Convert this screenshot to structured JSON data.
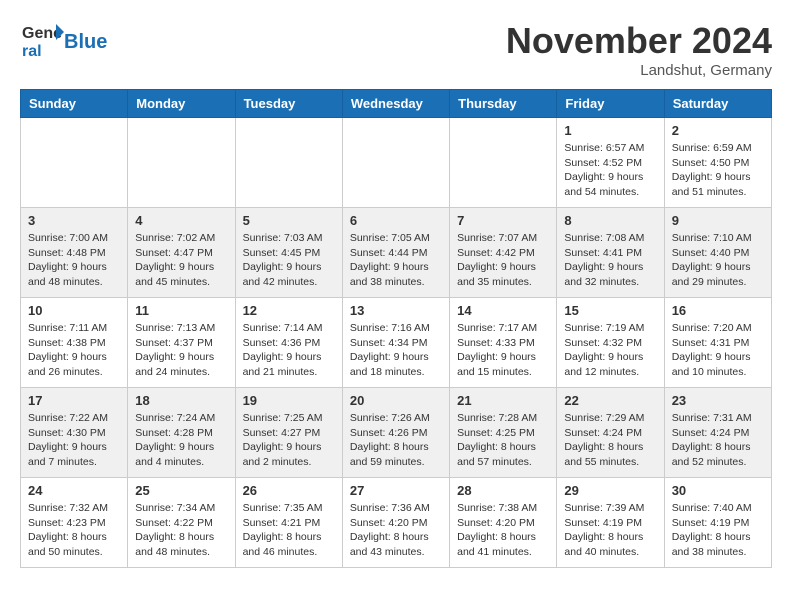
{
  "header": {
    "logo_line1": "General",
    "logo_line2": "Blue",
    "month": "November 2024",
    "location": "Landshut, Germany"
  },
  "weekdays": [
    "Sunday",
    "Monday",
    "Tuesday",
    "Wednesday",
    "Thursday",
    "Friday",
    "Saturday"
  ],
  "weeks": [
    {
      "days": [
        {
          "num": "",
          "info": ""
        },
        {
          "num": "",
          "info": ""
        },
        {
          "num": "",
          "info": ""
        },
        {
          "num": "",
          "info": ""
        },
        {
          "num": "",
          "info": ""
        },
        {
          "num": "1",
          "info": "Sunrise: 6:57 AM\nSunset: 4:52 PM\nDaylight: 9 hours\nand 54 minutes."
        },
        {
          "num": "2",
          "info": "Sunrise: 6:59 AM\nSunset: 4:50 PM\nDaylight: 9 hours\nand 51 minutes."
        }
      ]
    },
    {
      "days": [
        {
          "num": "3",
          "info": "Sunrise: 7:00 AM\nSunset: 4:48 PM\nDaylight: 9 hours\nand 48 minutes."
        },
        {
          "num": "4",
          "info": "Sunrise: 7:02 AM\nSunset: 4:47 PM\nDaylight: 9 hours\nand 45 minutes."
        },
        {
          "num": "5",
          "info": "Sunrise: 7:03 AM\nSunset: 4:45 PM\nDaylight: 9 hours\nand 42 minutes."
        },
        {
          "num": "6",
          "info": "Sunrise: 7:05 AM\nSunset: 4:44 PM\nDaylight: 9 hours\nand 38 minutes."
        },
        {
          "num": "7",
          "info": "Sunrise: 7:07 AM\nSunset: 4:42 PM\nDaylight: 9 hours\nand 35 minutes."
        },
        {
          "num": "8",
          "info": "Sunrise: 7:08 AM\nSunset: 4:41 PM\nDaylight: 9 hours\nand 32 minutes."
        },
        {
          "num": "9",
          "info": "Sunrise: 7:10 AM\nSunset: 4:40 PM\nDaylight: 9 hours\nand 29 minutes."
        }
      ]
    },
    {
      "days": [
        {
          "num": "10",
          "info": "Sunrise: 7:11 AM\nSunset: 4:38 PM\nDaylight: 9 hours\nand 26 minutes."
        },
        {
          "num": "11",
          "info": "Sunrise: 7:13 AM\nSunset: 4:37 PM\nDaylight: 9 hours\nand 24 minutes."
        },
        {
          "num": "12",
          "info": "Sunrise: 7:14 AM\nSunset: 4:36 PM\nDaylight: 9 hours\nand 21 minutes."
        },
        {
          "num": "13",
          "info": "Sunrise: 7:16 AM\nSunset: 4:34 PM\nDaylight: 9 hours\nand 18 minutes."
        },
        {
          "num": "14",
          "info": "Sunrise: 7:17 AM\nSunset: 4:33 PM\nDaylight: 9 hours\nand 15 minutes."
        },
        {
          "num": "15",
          "info": "Sunrise: 7:19 AM\nSunset: 4:32 PM\nDaylight: 9 hours\nand 12 minutes."
        },
        {
          "num": "16",
          "info": "Sunrise: 7:20 AM\nSunset: 4:31 PM\nDaylight: 9 hours\nand 10 minutes."
        }
      ]
    },
    {
      "days": [
        {
          "num": "17",
          "info": "Sunrise: 7:22 AM\nSunset: 4:30 PM\nDaylight: 9 hours\nand 7 minutes."
        },
        {
          "num": "18",
          "info": "Sunrise: 7:24 AM\nSunset: 4:28 PM\nDaylight: 9 hours\nand 4 minutes."
        },
        {
          "num": "19",
          "info": "Sunrise: 7:25 AM\nSunset: 4:27 PM\nDaylight: 9 hours\nand 2 minutes."
        },
        {
          "num": "20",
          "info": "Sunrise: 7:26 AM\nSunset: 4:26 PM\nDaylight: 8 hours\nand 59 minutes."
        },
        {
          "num": "21",
          "info": "Sunrise: 7:28 AM\nSunset: 4:25 PM\nDaylight: 8 hours\nand 57 minutes."
        },
        {
          "num": "22",
          "info": "Sunrise: 7:29 AM\nSunset: 4:24 PM\nDaylight: 8 hours\nand 55 minutes."
        },
        {
          "num": "23",
          "info": "Sunrise: 7:31 AM\nSunset: 4:24 PM\nDaylight: 8 hours\nand 52 minutes."
        }
      ]
    },
    {
      "days": [
        {
          "num": "24",
          "info": "Sunrise: 7:32 AM\nSunset: 4:23 PM\nDaylight: 8 hours\nand 50 minutes."
        },
        {
          "num": "25",
          "info": "Sunrise: 7:34 AM\nSunset: 4:22 PM\nDaylight: 8 hours\nand 48 minutes."
        },
        {
          "num": "26",
          "info": "Sunrise: 7:35 AM\nSunset: 4:21 PM\nDaylight: 8 hours\nand 46 minutes."
        },
        {
          "num": "27",
          "info": "Sunrise: 7:36 AM\nSunset: 4:20 PM\nDaylight: 8 hours\nand 43 minutes."
        },
        {
          "num": "28",
          "info": "Sunrise: 7:38 AM\nSunset: 4:20 PM\nDaylight: 8 hours\nand 41 minutes."
        },
        {
          "num": "29",
          "info": "Sunrise: 7:39 AM\nSunset: 4:19 PM\nDaylight: 8 hours\nand 40 minutes."
        },
        {
          "num": "30",
          "info": "Sunrise: 7:40 AM\nSunset: 4:19 PM\nDaylight: 8 hours\nand 38 minutes."
        }
      ]
    }
  ]
}
